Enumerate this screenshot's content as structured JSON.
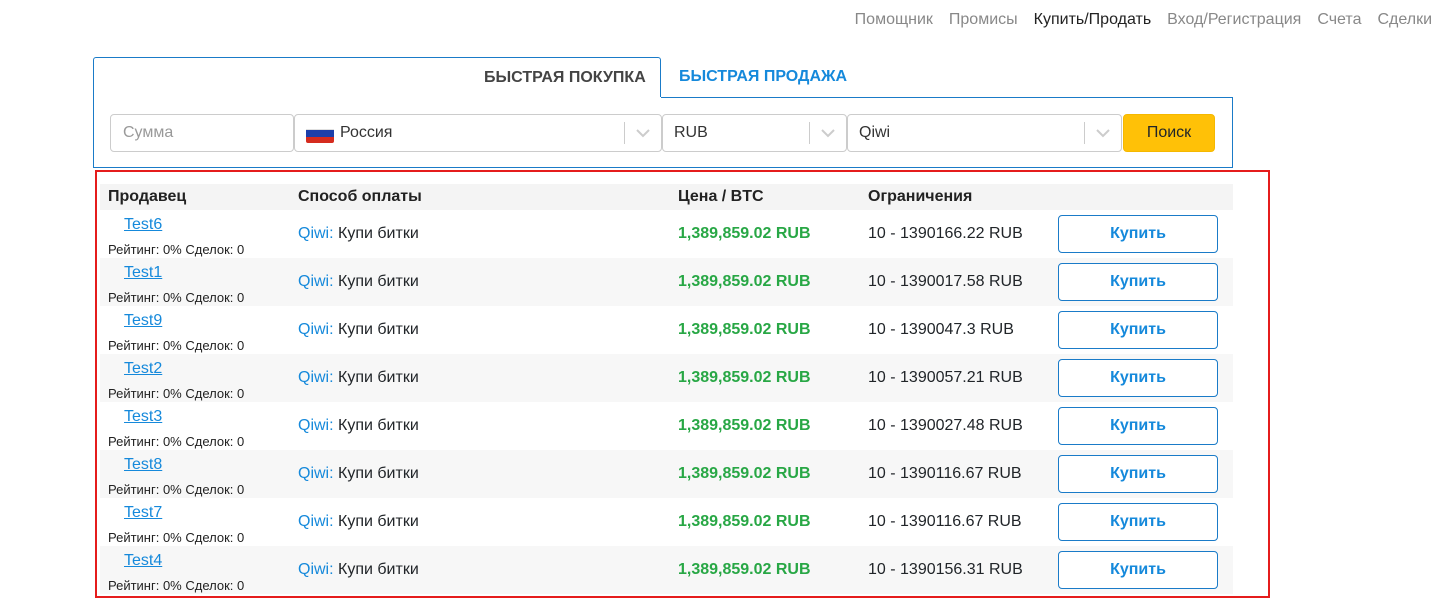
{
  "nav": [
    "Помощник",
    "Промисы",
    "Купить/Продать",
    "Вход/Регистрация",
    "Счета",
    "Сделки"
  ],
  "tabs": {
    "buy": "БЫСТРАЯ ПОКУПКА",
    "sell": "БЫСТРАЯ ПРОДАЖА"
  },
  "filters": {
    "amount_placeholder": "Сумма",
    "country": "Россия",
    "currency": "RUB",
    "method": "Qiwi",
    "search": "Поиск"
  },
  "table": {
    "headers": [
      "Продавец",
      "Способ оплаты",
      "Цена / BTC",
      "Ограничения"
    ],
    "rows": [
      {
        "seller": "Test6",
        "meta": "Рейтинг: 0% Сделок: 0",
        "method": "Qiwi:",
        "desc": "Купи битки",
        "price": "1,389,859.02 RUB",
        "limits": "10 - 1390166.22 RUB",
        "action": "Купить"
      },
      {
        "seller": "Test1",
        "meta": "Рейтинг: 0% Сделок: 0",
        "method": "Qiwi:",
        "desc": "Купи битки",
        "price": "1,389,859.02 RUB",
        "limits": "10 - 1390017.58 RUB",
        "action": "Купить"
      },
      {
        "seller": "Test9",
        "meta": "Рейтинг: 0% Сделок: 0",
        "method": "Qiwi:",
        "desc": "Купи битки",
        "price": "1,389,859.02 RUB",
        "limits": "10 - 1390047.3 RUB",
        "action": "Купить"
      },
      {
        "seller": "Test2",
        "meta": "Рейтинг: 0% Сделок: 0",
        "method": "Qiwi:",
        "desc": "Купи битки",
        "price": "1,389,859.02 RUB",
        "limits": "10 - 1390057.21 RUB",
        "action": "Купить"
      },
      {
        "seller": "Test3",
        "meta": "Рейтинг: 0% Сделок: 0",
        "method": "Qiwi:",
        "desc": "Купи битки",
        "price": "1,389,859.02 RUB",
        "limits": "10 - 1390027.48 RUB",
        "action": "Купить"
      },
      {
        "seller": "Test8",
        "meta": "Рейтинг: 0% Сделок: 0",
        "method": "Qiwi:",
        "desc": "Купи битки",
        "price": "1,389,859.02 RUB",
        "limits": "10 - 1390116.67 RUB",
        "action": "Купить"
      },
      {
        "seller": "Test7",
        "meta": "Рейтинг: 0% Сделок: 0",
        "method": "Qiwi:",
        "desc": "Купи битки",
        "price": "1,389,859.02 RUB",
        "limits": "10 - 1390116.67 RUB",
        "action": "Купить"
      },
      {
        "seller": "Test4",
        "meta": "Рейтинг: 0% Сделок: 0",
        "method": "Qiwi:",
        "desc": "Купи битки",
        "price": "1,389,859.02 RUB",
        "limits": "10 - 1390156.31 RUB",
        "action": "Купить"
      }
    ]
  },
  "colors": {
    "accent": "#1589db",
    "price": "#28a745",
    "search_button": "#ffc107",
    "highlight_border": "#e51c1c"
  },
  "icons": {
    "select_arrow": "chevron-down-icon",
    "country_flag": "russia-flag-icon"
  }
}
